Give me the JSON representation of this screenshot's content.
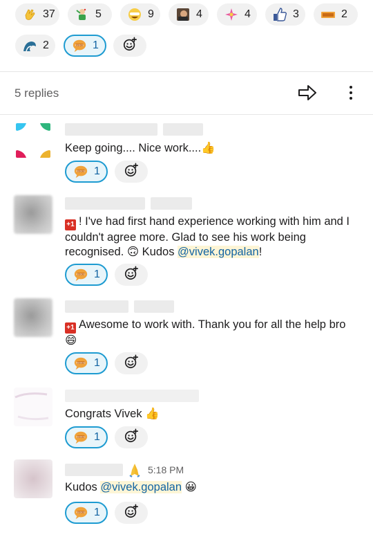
{
  "reactions_top": [
    {
      "icon": "clap-emoji-icon",
      "count": "37"
    },
    {
      "icon": "party-person-emoji-icon",
      "count": "5"
    },
    {
      "icon": "happy-face-emoji-icon",
      "count": "9"
    },
    {
      "icon": "photo-emoji-icon",
      "count": "4"
    },
    {
      "icon": "sparkle-emoji-icon",
      "count": "4"
    },
    {
      "icon": "thumbs-up-emoji-icon",
      "count": "3"
    },
    {
      "icon": "ticket-emoji-icon",
      "count": "2"
    },
    {
      "icon": "wave-emoji-icon",
      "count": "2"
    },
    {
      "icon": "kudos-emoji-icon",
      "count": "1"
    }
  ],
  "thread": {
    "replies_label": "5 replies"
  },
  "messages": [
    {
      "text": "Keep going.... Nice work....👍",
      "reaction_count": "1"
    },
    {
      "text_parts": [
        "! I've had first hand experience working with him and I couldn't agree more. Glad to see his work being recognised. 🙃 Kudos ",
        "@vivek.gopalan",
        "!"
      ],
      "reaction_count": "1"
    },
    {
      "text": "Awesome to work with. Thank you for all the help bro 😄",
      "reaction_count": "1"
    },
    {
      "text": "Congrats Vivek 👍",
      "reaction_count": "1"
    },
    {
      "timestamp": "5:18 PM",
      "text_parts": [
        "Kudos ",
        "@vivek.gopalan",
        " 😀"
      ],
      "reaction_count": "1"
    }
  ],
  "badge_plus_one": "+1",
  "colors": {
    "accent": "#1d9bd1",
    "mention_bg": "#fdf5d6",
    "mention_text": "#1264a3"
  }
}
